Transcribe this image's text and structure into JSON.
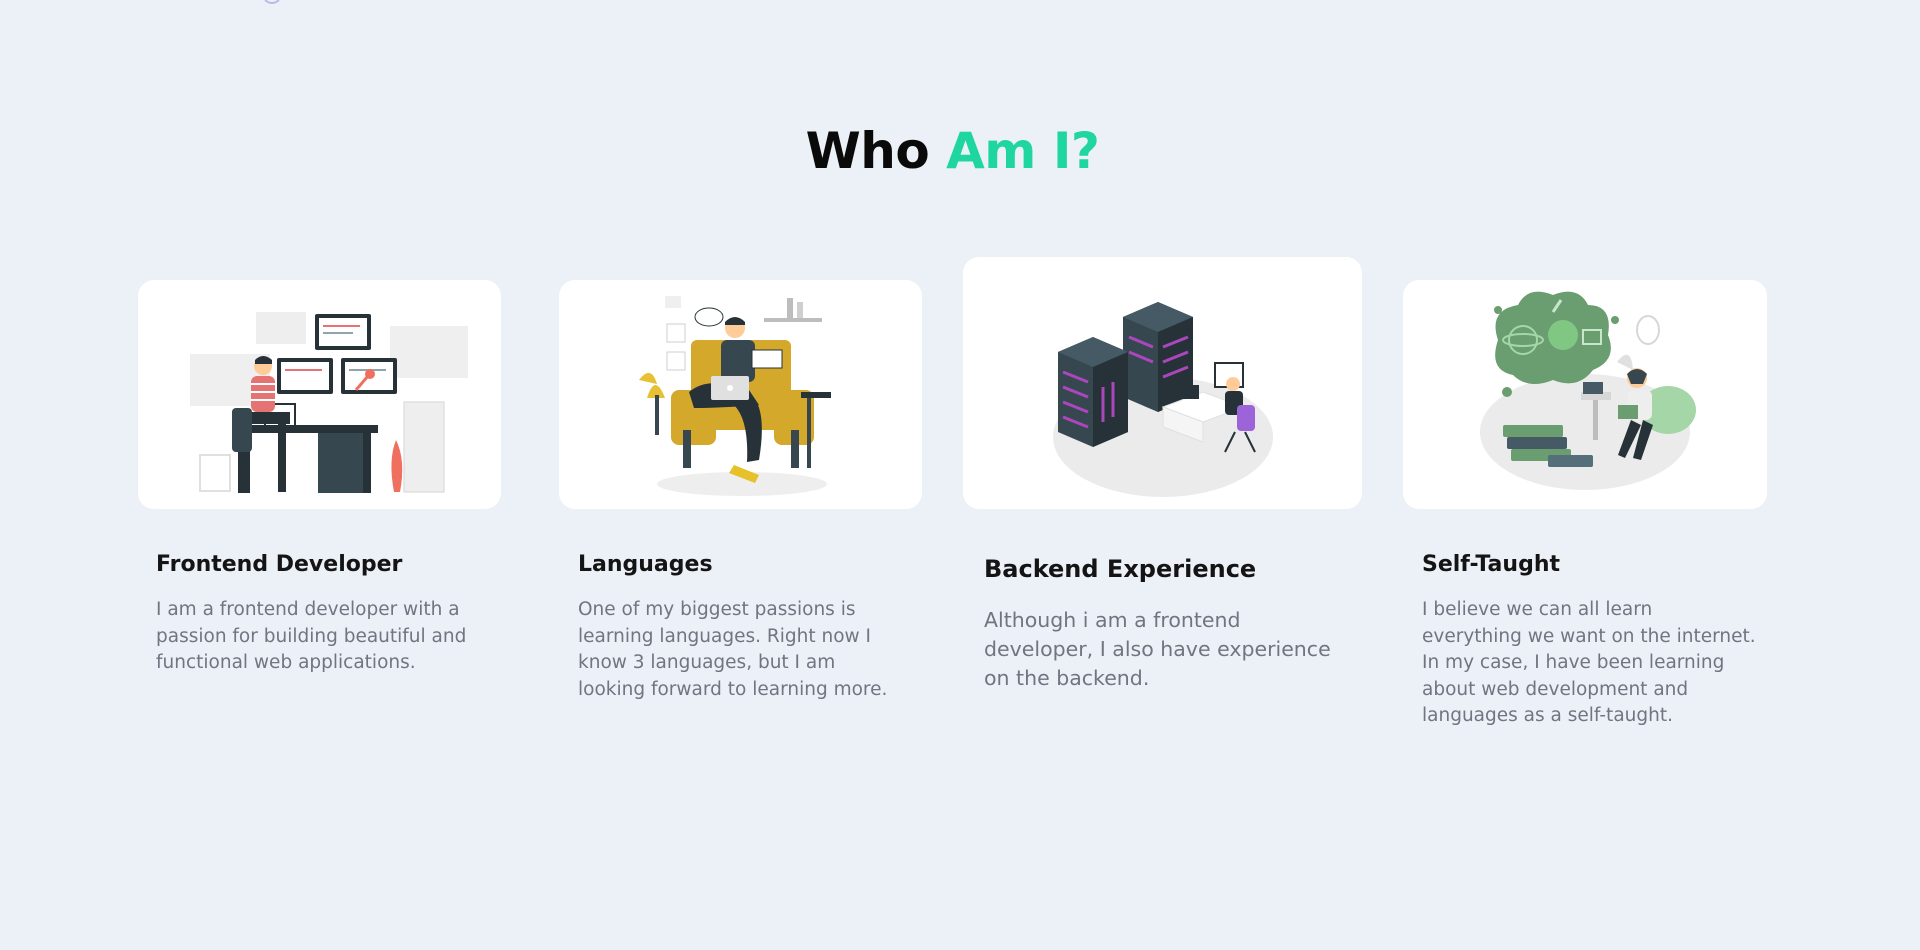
{
  "section": {
    "title_part1": "Who",
    "title_part2": "Am I?",
    "accent_color": "#1fd6a0"
  },
  "cards": [
    {
      "illustration": "developer-at-desk-illustration",
      "title": "Frontend Developer",
      "description": "I am a frontend developer with a passion for building beautiful and functional web applications."
    },
    {
      "illustration": "person-with-laptop-illustration",
      "title": "Languages",
      "description": "One of my biggest passions is learning languages. Right now I know 3 languages, but I am looking forward to learning more."
    },
    {
      "illustration": "server-racks-illustration",
      "title": "Backend Experience",
      "description": "Although i am a frontend developer, I also have experience on the backend."
    },
    {
      "illustration": "self-learning-illustration",
      "title": "Self-Taught",
      "description": "I believe we can all learn everything we want on the internet. In my case, I have been learning about web development and languages as a self-taught."
    }
  ]
}
